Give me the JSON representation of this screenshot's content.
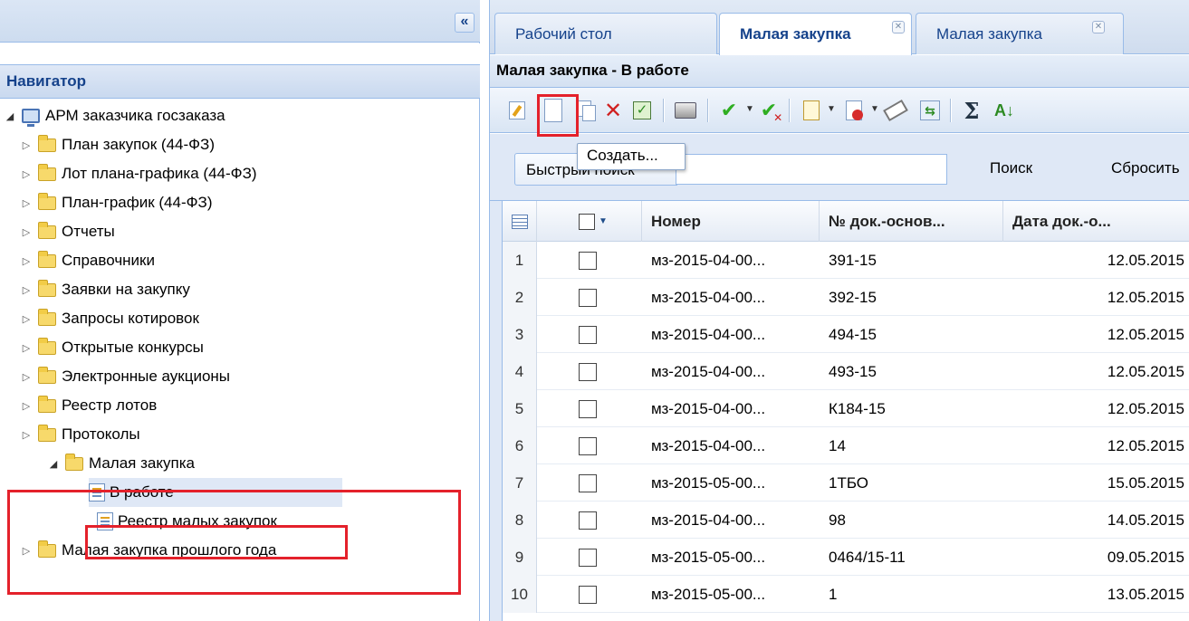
{
  "left": {
    "collapse_symbol": "«",
    "nav_title": "Навигатор",
    "tree": [
      {
        "label": "АРМ заказчика госзаказа",
        "kind": "root"
      },
      {
        "label": "План закупок (44-ФЗ)",
        "kind": "folder"
      },
      {
        "label": "Лот плана-графика (44-ФЗ)",
        "kind": "folder"
      },
      {
        "label": "План-график (44-ФЗ)",
        "kind": "folder"
      },
      {
        "label": "Отчеты",
        "kind": "folder"
      },
      {
        "label": "Справочники",
        "kind": "folder"
      },
      {
        "label": "Заявки на закупку",
        "kind": "folder"
      },
      {
        "label": "Запросы котировок",
        "kind": "folder"
      },
      {
        "label": "Открытые конкурсы",
        "kind": "folder"
      },
      {
        "label": "Электронные аукционы",
        "kind": "folder"
      },
      {
        "label": "Реестр лотов",
        "kind": "folder"
      },
      {
        "label": "Протоколы",
        "kind": "folder"
      },
      {
        "label": "Малая закупка",
        "kind": "folder-open"
      },
      {
        "label": "В работе",
        "kind": "doc-selected"
      },
      {
        "label": "Реестр малых закупок",
        "kind": "doc"
      },
      {
        "label": "Малая закупка прошлого года",
        "kind": "folder"
      }
    ]
  },
  "tabs": [
    {
      "label": "Рабочий стол"
    },
    {
      "label": "Малая закупка"
    },
    {
      "label": "Малая закупка"
    }
  ],
  "tab_close_symbol": "✕",
  "panel_title": "Малая закупка - В работе",
  "tooltip": "Создать...",
  "search": {
    "label": "Быстрый поиск",
    "value": "",
    "search_btn": "Поиск",
    "reset_btn": "Сбросить"
  },
  "grid": {
    "columns": [
      "Номер",
      "№ док.-основ...",
      "Дата док.-о..."
    ],
    "rows": [
      {
        "n": "1",
        "num": "мз-2015-04-00...",
        "doc": "391-15",
        "date": "12.05.2015"
      },
      {
        "n": "2",
        "num": "мз-2015-04-00...",
        "doc": "392-15",
        "date": "12.05.2015"
      },
      {
        "n": "3",
        "num": "мз-2015-04-00...",
        "doc": "494-15",
        "date": "12.05.2015"
      },
      {
        "n": "4",
        "num": "мз-2015-04-00...",
        "doc": "493-15",
        "date": "12.05.2015"
      },
      {
        "n": "5",
        "num": "мз-2015-04-00...",
        "doc": "К184-15",
        "date": "12.05.2015"
      },
      {
        "n": "6",
        "num": "мз-2015-04-00...",
        "doc": "14",
        "date": "12.05.2015"
      },
      {
        "n": "7",
        "num": "мз-2015-05-00...",
        "doc": "1ТБО",
        "date": "15.05.2015"
      },
      {
        "n": "8",
        "num": "мз-2015-04-00...",
        "doc": "98",
        "date": "14.05.2015"
      },
      {
        "n": "9",
        "num": "мз-2015-05-00...",
        "doc": "0464/15-11",
        "date": "09.05.2015"
      },
      {
        "n": "10",
        "num": "мз-2015-05-00...",
        "doc": "1",
        "date": "13.05.2015"
      }
    ]
  },
  "colors": {
    "accent_dark": "#15428b",
    "highlight_red": "#e4212b",
    "selected_row": "#dfe8f6"
  }
}
